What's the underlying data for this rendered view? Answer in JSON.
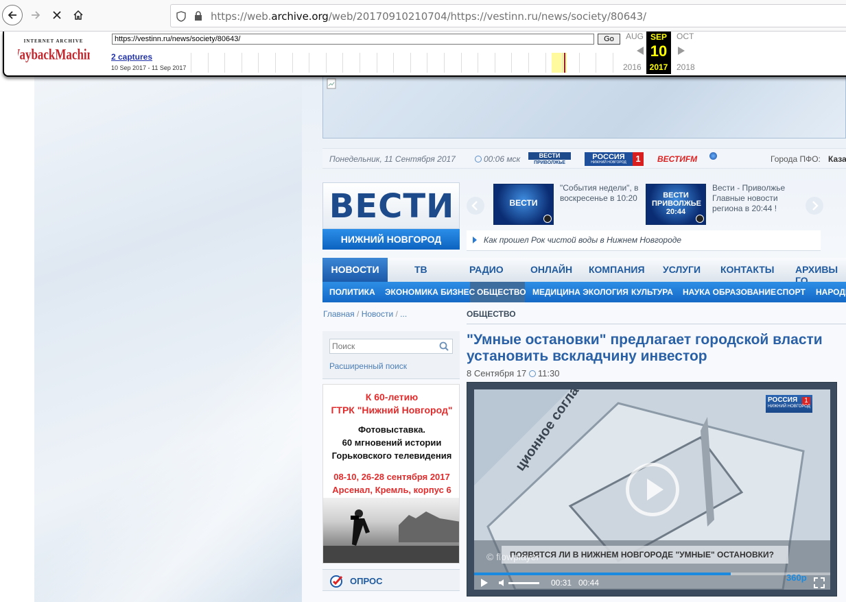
{
  "browser": {
    "url_prefix": "https://web.",
    "url_domain": "archive.org",
    "url_rest": "/web/20170910210704/https://vestinn.ru/news/society/80643/"
  },
  "wayback": {
    "url_input": "https://vestinn.ru/news/society/80643/",
    "go_label": "Go",
    "captures": "2 captures",
    "range": "10 Sep 2017 - 11 Sep 2017",
    "prev_month": "AUG",
    "cur_month": "SEP",
    "next_month": "OCT",
    "day": "10",
    "prev_year": "2016",
    "cur_year": "2017",
    "next_year": "2018",
    "logo_top": "INTERNET ARCHIVE",
    "logo_main": "WaybackMachine"
  },
  "date_bar": {
    "date": "Понедельник, 11 Сентября 2017",
    "time": "00:06 мск",
    "logo1_top": "ВЕСТИ",
    "logo1_bottom": "ПРИВОЛЖЬЕ",
    "logo2_top": "РОССИЯ",
    "logo2_bottom": "НИЖНИЙ НОВГОРОД",
    "logo2_num": "1",
    "logo3": "ВЕСТИFM",
    "cities_label": "Города ПФО:",
    "cities_value": "Каза"
  },
  "logo": {
    "title": "ВЕСТИ",
    "city": "НИЖНИЙ НОВГОРОД"
  },
  "promos": [
    {
      "thumb": "ВЕСТИ",
      "text": "\"События недели\", в воскресенье в 10:20"
    },
    {
      "thumb": "ВЕСТИ ПРИВОЛЖЬЕ 20:44",
      "text": "Вести - Приволжье Главные новости региона в 20:44 !"
    }
  ],
  "ticker": "Как прошел Рок чистой воды в Нижнем Новгороде",
  "nav_main": [
    "НОВОСТИ",
    "ТВ",
    "РАДИО",
    "ОНЛАЙН",
    "КОМПАНИЯ",
    "УСЛУГИ",
    "КОНТАКТЫ",
    "АРХИВЫ ГО"
  ],
  "nav_sub": [
    "ПОЛИТИКА",
    "ЭКОНОМИКА БИЗНЕС",
    "ОБЩЕСТВО",
    "МЕДИЦИНА ЭКОЛОГИЯ",
    "КУЛЬТУРА",
    "НАУКА ОБРАЗОВАНИЕ",
    "СПОРТ",
    "НАРОДН"
  ],
  "breadcrumb": {
    "home": "Главная",
    "news": "Новости",
    "more": "..."
  },
  "section_title": "ОБЩЕСТВО",
  "search": {
    "placeholder": "Поиск",
    "advanced": "Расширенный поиск"
  },
  "poster": {
    "line1": "К 60-летию",
    "line2": "ГТРК \"Нижний Новгород\"",
    "line3": "Фотовыставка.",
    "line4": "60 мгновений истории",
    "line5": "Горьковского телевидения",
    "line6": "08-10, 26-28 сентября 2017",
    "line7": "Арсенал, Кремль, корпус 6"
  },
  "poll": {
    "label": "ОПРОС"
  },
  "article": {
    "title": "\"Умные остановки\" предлагает городской власти установить вскладчину инвестор",
    "date": "8 Сентября 17",
    "time": "11:30"
  },
  "video": {
    "caption": "ПОЯВЯТСЯ ЛИ В НИЖНЕМ НОВГОРОДЕ \"УМНЫЕ\" ОСТАНОВКИ?",
    "watermark": "flowplayer",
    "channel": "РОССИЯ",
    "channel_sub": "НИЖНИЙ НОВГОРОД",
    "channel_num": "1",
    "current_time": "00:31",
    "duration": "00:44",
    "quality": "360p",
    "progress": 0.72
  },
  "colors": {
    "accent": "#1c5aa9",
    "link": "#2a61a6",
    "wayback_yellow": "#ffff00"
  }
}
